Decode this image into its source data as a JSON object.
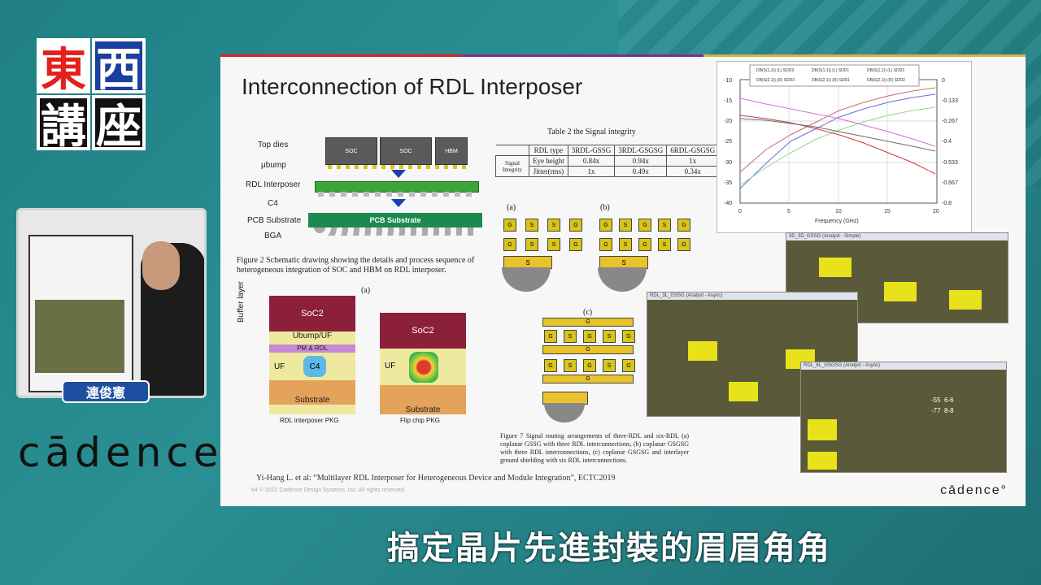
{
  "logo": {
    "c1": "東",
    "c2": "西",
    "c3": "講",
    "c4": "座"
  },
  "speaker": {
    "name": "連俊憲"
  },
  "brand": {
    "cadence_large": "cādence",
    "cadence_small": "cādence°"
  },
  "subtitle": "搞定晶片先進封裝的眉眉角角",
  "slide": {
    "title": "Interconnection of RDL Interposer",
    "fig2": {
      "labels": {
        "top_dies": "Top dies",
        "ubump": "μbump",
        "rdl_interposer": "RDL Interposer",
        "c4": "C4",
        "pcb_substrate": "PCB Substrate",
        "bga": "BGA"
      },
      "dies": [
        "SOC",
        "SOC",
        "HBM"
      ],
      "pcb_text": "PCB Substrate",
      "caption": "Figure 2 Schematic drawing showing the details and process sequence of heterogeneous integration of SOC and HBM on RDL interposer."
    },
    "pkg": {
      "a_label": "(a)",
      "buffer": "Buffer layer",
      "left": {
        "soc": "SoC2",
        "ubump": "Ubump/UF",
        "pm": "PM & RDL",
        "uf": "UF",
        "c4": "C4",
        "substrate": "Substrate",
        "caption": "RDL interposer PKG"
      },
      "right": {
        "soc": "SoC2",
        "uf": "UF",
        "substrate": "Substrate",
        "caption": "Flip chip PKG"
      }
    },
    "table": {
      "title": "Table 2 the Signal integrity",
      "header": [
        "RDL type",
        "3RDL-GSSG",
        "3RDL-GSGSG",
        "6RDL-GSGSG"
      ],
      "row_group": "Signal Integrity",
      "rows": [
        [
          "Eye height",
          "0.84x",
          "0.94x",
          "1x"
        ],
        [
          "Jitter(rms)",
          "1x",
          "0.49x",
          "0.34x"
        ]
      ]
    },
    "routing": {
      "a": "(a)",
      "b": "(b)",
      "c": "(c)",
      "g": "G",
      "s": "S",
      "caption": "Figure 7 Signal routing arrangements of three-RDL and six-RDL (a) coplanar GSSG with three RDL interconnections, (b) coplanar GSGSG with three RDL interconnections, (c) coplanar GSGSG and interlayer ground shielding with six RDL interconnections."
    },
    "plot": {
      "legend": [
        "DB(S(1,1)) (L) SDD3",
        "DB(S(1,1)) (L) SDD1",
        "DB(S(1,1)) (L) SDD2",
        "DB(S(2,1)) (R) SDD3",
        "DB(S(2,1)) (R) SDD1",
        "DB(S(2,1)) (R) SDD2"
      ],
      "yleft": [
        "-10",
        "-15",
        "-20",
        "-25",
        "-30",
        "-35",
        "-40"
      ],
      "yright": [
        "0",
        "-0.133",
        "-0.267",
        "-0.4",
        "-0.533",
        "-0.667",
        "-0.8"
      ],
      "xticks": [
        "0",
        "5",
        "10",
        "15",
        "20"
      ],
      "xlabel": "Frequency (GHz)"
    },
    "shots": {
      "s1_title": "3D_3D_GSSG (Analyst - Simple)",
      "s2_title": "RDL_3L_GSSG (Analyst - Async)",
      "s3_title": "RDL_6L_GSGSG (Analyst - Async)",
      "s3_labels": [
        "-55",
        "6-6",
        "-77",
        "8-8"
      ]
    },
    "footer_ref": "Yi-Hang L. et al: “Multilayer RDL Interposer for Heterogeneous Device and Module Integration”, ECTC2019",
    "footer_copy": "64     © 2022 Cadence Design Systems, Inc. All rights reserved."
  }
}
